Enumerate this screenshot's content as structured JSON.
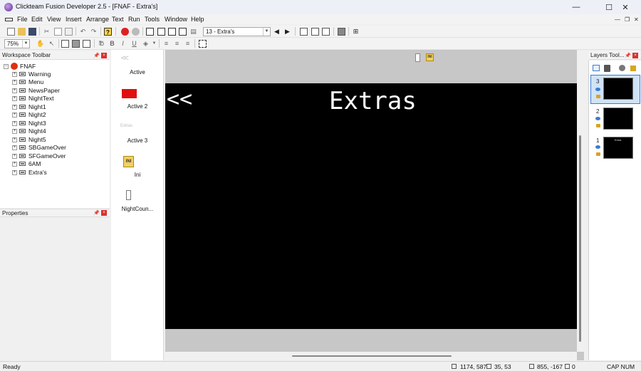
{
  "window": {
    "title": "Clickteam Fusion Developer 2.5 - [FNAF - Extra's]",
    "minimize": "—",
    "maximize": "☐",
    "close": "✕"
  },
  "menu": {
    "items": [
      "File",
      "Edit",
      "View",
      "Insert",
      "Arrange",
      "Text",
      "Run",
      "Tools",
      "Window",
      "Help"
    ],
    "mdi_minimize": "—",
    "mdi_restore": "❐",
    "mdi_close": "✕"
  },
  "toolbar": {
    "frame_selector": "13 - Extra's",
    "zoom": "75%",
    "bold": "B",
    "italic": "I",
    "underline": "U"
  },
  "workspace": {
    "header": "Workspace Toolbar",
    "root": "FNAF",
    "frames": [
      "Warning",
      "Menu",
      "NewsPaper",
      "NightText",
      "Night1",
      "Night2",
      "Night3",
      "Night4",
      "Night5",
      "SBGameOver",
      "SFGameOver",
      "6AM",
      "Extra's"
    ]
  },
  "properties": {
    "header": "Properties"
  },
  "objects": {
    "items": [
      {
        "label": "Active",
        "icon": "back-arrows-icon"
      },
      {
        "label": "Active 2",
        "icon": "red-rectangle-icon",
        "color": "#e01010"
      },
      {
        "label": "Active 3",
        "icon": "extras-text-icon",
        "thumb_text": "Extras"
      },
      {
        "label": "Ini",
        "icon": "ini-file-icon",
        "thumb_text": "INI"
      },
      {
        "label": "NightCoun...",
        "icon": "counter-icon"
      }
    ]
  },
  "frame_editor": {
    "back_text": "<<",
    "title_text": "Extras",
    "ini_badge": "INI",
    "frame_color": "#000000",
    "outside_color": "#c7c7c7"
  },
  "layers": {
    "header": "Layers Tool...",
    "items": [
      {
        "number": "3",
        "selected": true,
        "thumb_text": ""
      },
      {
        "number": "2",
        "selected": false,
        "thumb_text": ""
      },
      {
        "number": "1",
        "selected": false,
        "thumb_text": "Extra"
      }
    ]
  },
  "status": {
    "ready": "Ready",
    "coords": "1174, 587",
    "size": "35, 53",
    "offset": "855, -167",
    "count": "0",
    "keys": "CAP NUM"
  }
}
